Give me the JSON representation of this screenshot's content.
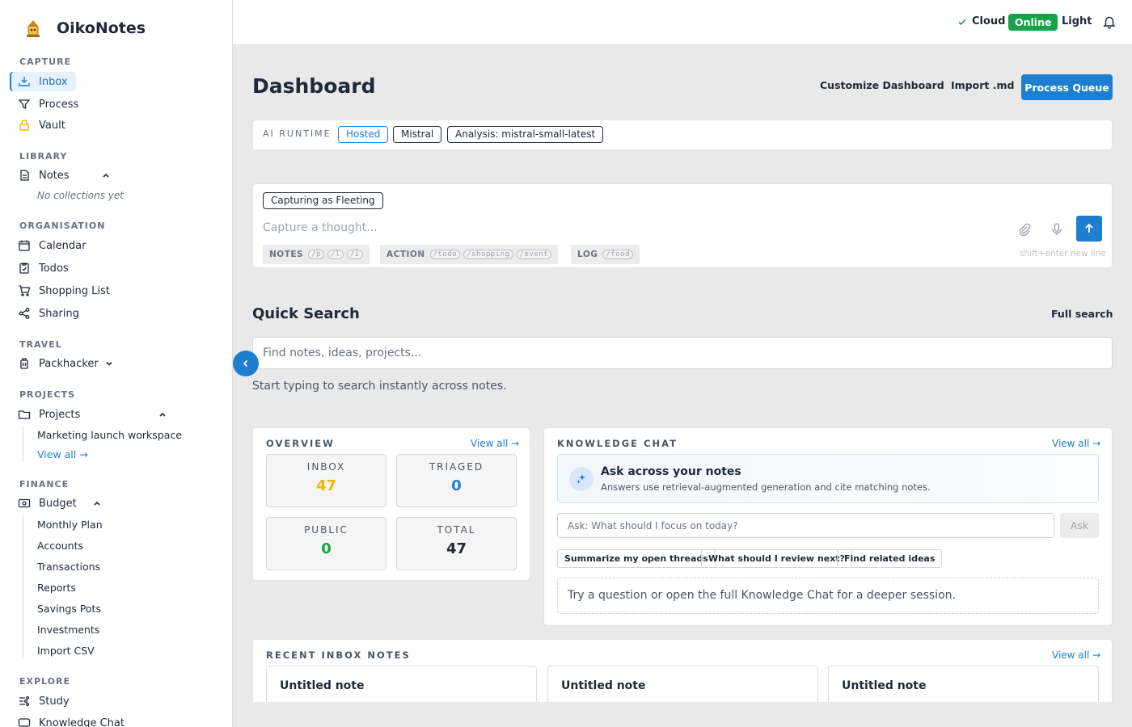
{
  "app": {
    "name": "OikoNotes"
  },
  "sidebar": {
    "capture": {
      "title": "CAPTURE",
      "items": [
        {
          "label": "Inbox"
        },
        {
          "label": "Process"
        },
        {
          "label": "Vault"
        }
      ]
    },
    "library": {
      "title": "LIBRARY",
      "notes_label": "Notes",
      "empty": "No collections yet"
    },
    "organisation": {
      "title": "ORGANISATION",
      "items": [
        {
          "label": "Calendar"
        },
        {
          "label": "Todos"
        },
        {
          "label": "Shopping List"
        },
        {
          "label": "Sharing"
        }
      ]
    },
    "travel": {
      "title": "TRAVEL",
      "packhacker": "Packhacker"
    },
    "projects": {
      "title": "PROJECTS",
      "label": "Projects",
      "children": [
        "Marketing launch workspace"
      ],
      "view_all": "View all →"
    },
    "finance": {
      "title": "FINANCE",
      "label": "Budget",
      "children": [
        "Monthly Plan",
        "Accounts",
        "Transactions",
        "Reports",
        "Savings Pots",
        "Investments",
        "Import CSV"
      ]
    },
    "explore": {
      "title": "EXPLORE",
      "items": [
        {
          "label": "Study"
        },
        {
          "label": "Knowledge Chat"
        }
      ]
    }
  },
  "topbar": {
    "cloud": "Cloud",
    "status": "Online",
    "theme": "Light"
  },
  "header": {
    "title": "Dashboard",
    "customize": "Customize Dashboard",
    "import": "Import .md",
    "process": "Process Queue"
  },
  "runtime": {
    "label": "AI RUNTIME",
    "tags": [
      "Hosted",
      "Mistral",
      "Analysis: mistral-small-latest"
    ]
  },
  "capture": {
    "badge": "Capturing as Fleeting",
    "placeholder": "Capture a thought...",
    "groups": [
      {
        "label": "NOTES",
        "cmds": [
          "/p",
          "/l",
          "/i"
        ]
      },
      {
        "label": "ACTION",
        "cmds": [
          "/todo",
          "/shopping",
          "/event"
        ]
      },
      {
        "label": "LOG",
        "cmds": [
          "/food"
        ]
      }
    ],
    "hint": "shift+enter new line"
  },
  "quick_search": {
    "title": "Quick Search",
    "full": "Full search",
    "placeholder": "Find notes, ideas, projects...",
    "help": "Start typing to search instantly across notes."
  },
  "overview": {
    "title": "OVERVIEW",
    "view_all": "View all →",
    "stats": [
      {
        "label": "INBOX",
        "value": "47",
        "color": "#f2b600"
      },
      {
        "label": "TRIAGED",
        "value": "0",
        "color": "#1e7fd1"
      },
      {
        "label": "PUBLIC",
        "value": "0",
        "color": "#17a34a"
      },
      {
        "label": "TOTAL",
        "value": "47",
        "color": "#1f2937"
      }
    ]
  },
  "knowledge_chat": {
    "title": "KNOWLEDGE CHAT",
    "view_all": "View all →",
    "ask_title": "Ask across your notes",
    "ask_sub": "Answers use retrieval-augmented generation and cite matching notes.",
    "placeholder": "Ask: What should I focus on today?",
    "ask_btn": "Ask",
    "suggestions": [
      "Summarize my open threads",
      "What should I review next?",
      "Find related ideas"
    ],
    "footer": "Try a question or open the full Knowledge Chat for a deeper session."
  },
  "recent": {
    "title": "RECENT INBOX NOTES",
    "view_all": "View all →",
    "notes": [
      "Untitled note",
      "Untitled note",
      "Untitled note"
    ]
  },
  "colors": {
    "accent": "#1e7fd1",
    "online": "#17a34a",
    "inbox": "#f2b600"
  }
}
